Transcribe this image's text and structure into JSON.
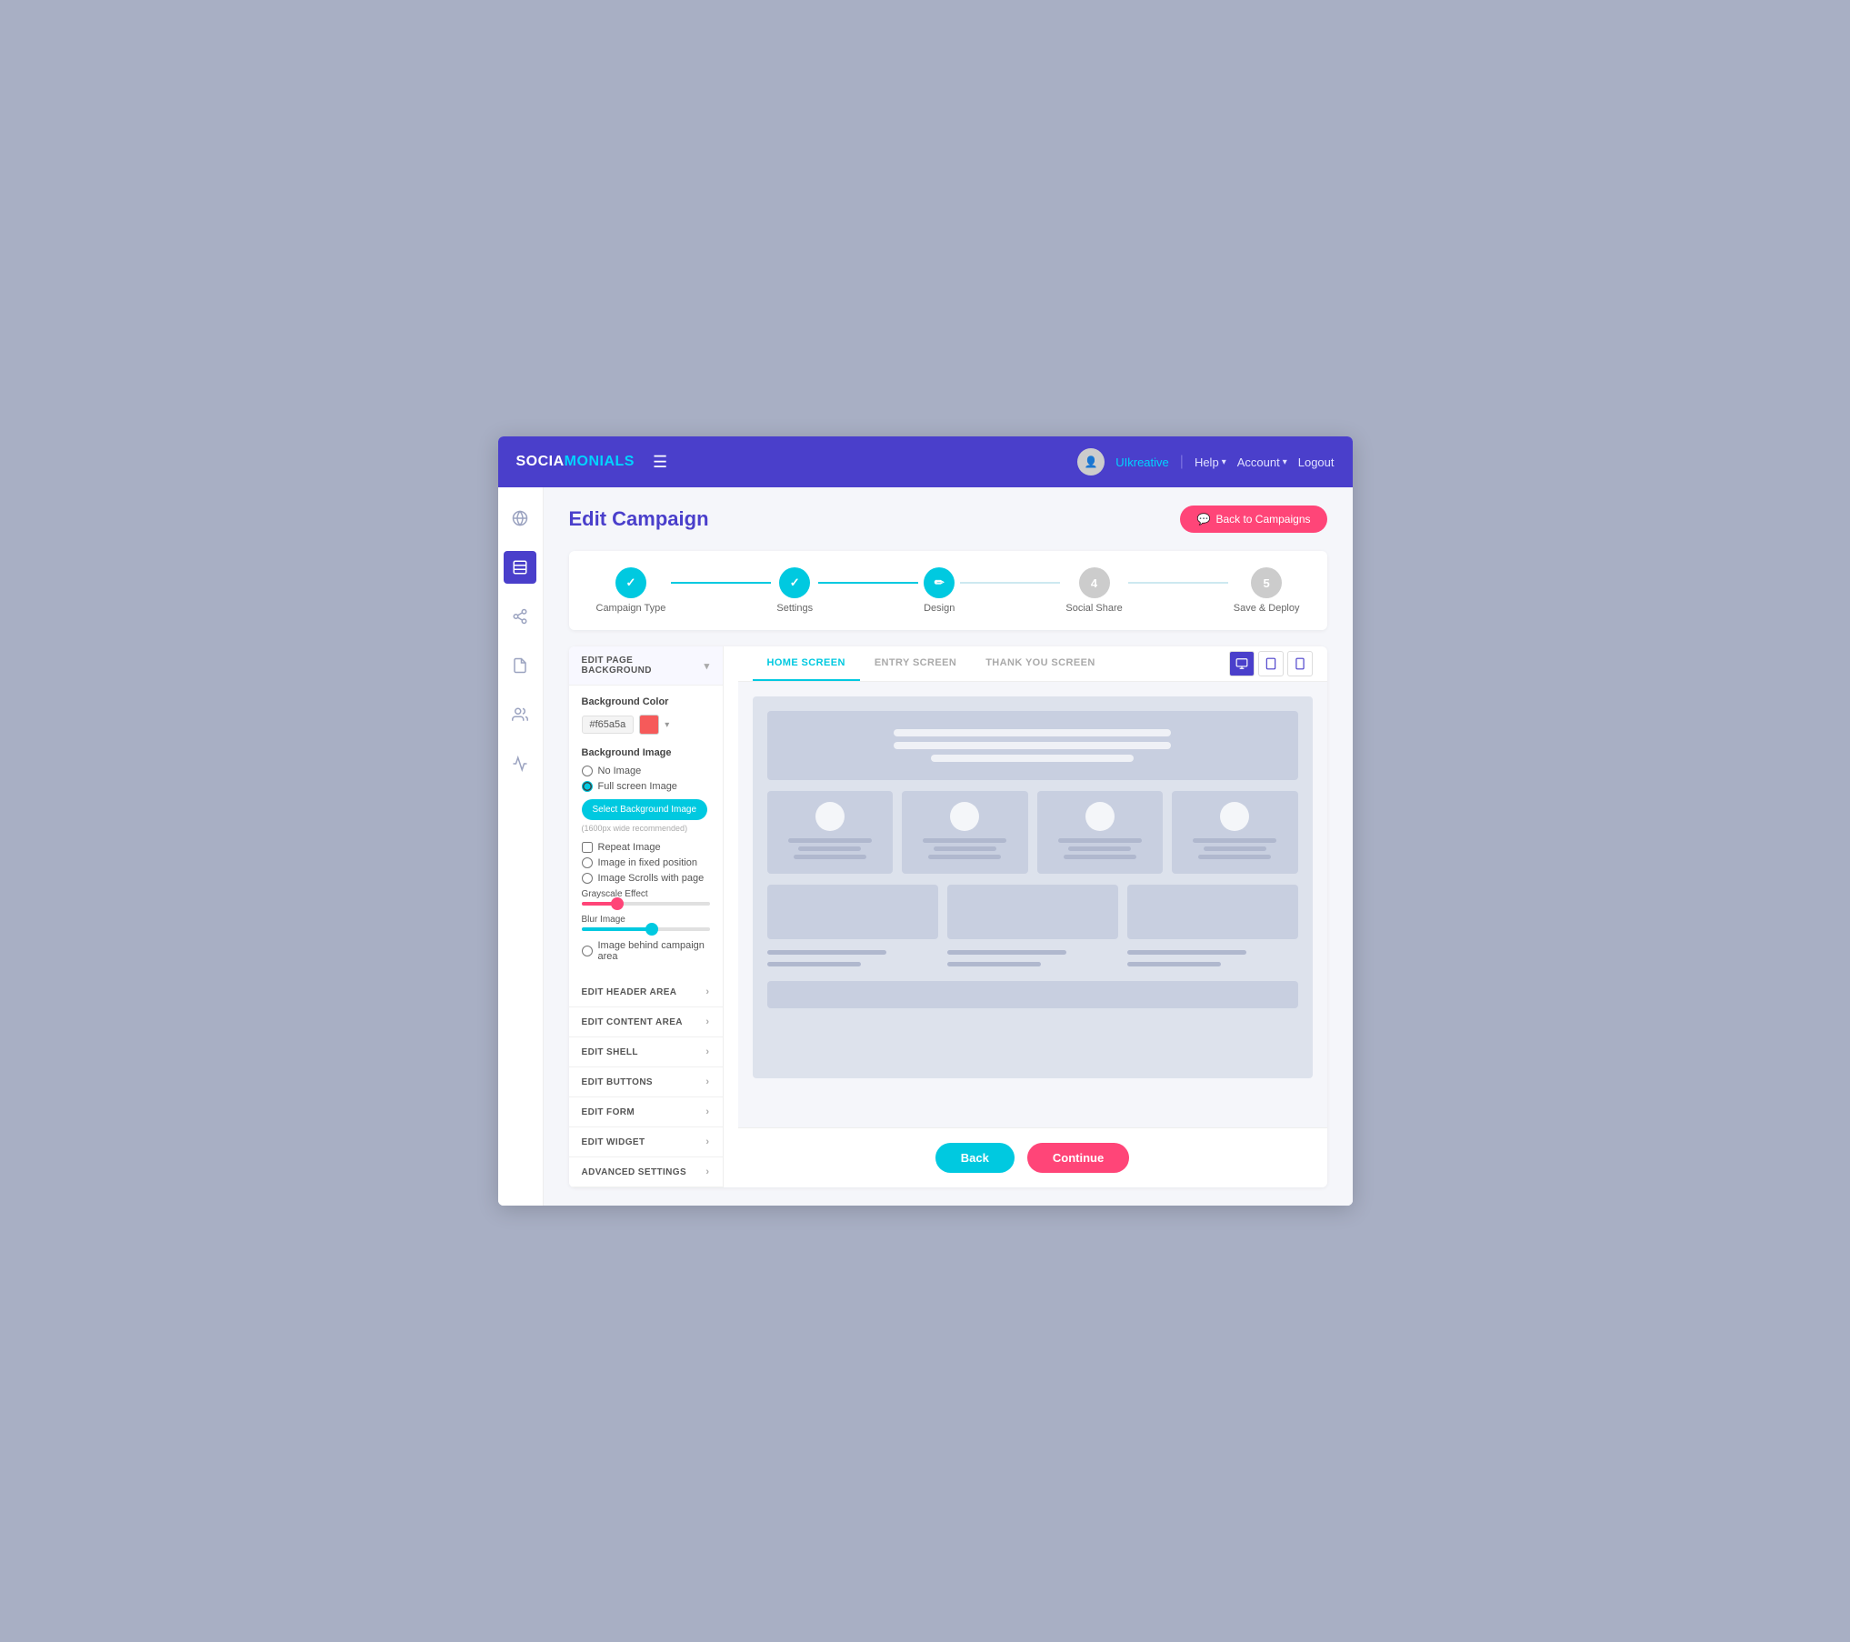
{
  "app": {
    "logo_prefix": "SOCIA",
    "logo_highlight": "MONIALS"
  },
  "nav": {
    "hamburger": "☰",
    "username": "UIkreative",
    "help_label": "Help",
    "account_label": "Account",
    "logout_label": "Logout"
  },
  "page": {
    "title": "Edit Campaign",
    "back_btn": "Back to Campaigns"
  },
  "steps": [
    {
      "id": "campaign-type",
      "label": "Campaign Type",
      "state": "done",
      "icon": "check"
    },
    {
      "id": "settings",
      "label": "Settings",
      "state": "done",
      "icon": "check"
    },
    {
      "id": "design",
      "label": "Design",
      "state": "active",
      "icon": "pen"
    },
    {
      "id": "social-share",
      "label": "Social Share",
      "state": "inactive",
      "number": "4"
    },
    {
      "id": "save-deploy",
      "label": "Save  & Deploy",
      "state": "inactive",
      "number": "5"
    }
  ],
  "left_panel": {
    "dropdown_label": "EDIT PAGE BACKGROUND",
    "bg_color_label": "Background Color",
    "bg_color_value": "#f65a5a",
    "bg_image_label": "Background Image",
    "radio_no_image": "No Image",
    "radio_fullscreen": "Full screen Image",
    "select_bg_btn": "Select Background Image",
    "hint_text": "(1600px wide recommended)",
    "checkbox_repeat": "Repeat Image",
    "radio_fixed": "Image in fixed position",
    "radio_scrolls": "Image Scrolls with page",
    "grayscale_label": "Grayscale Effect",
    "blur_label": "Blur Image",
    "grayscale_pct": 28,
    "blur_pct": 55,
    "image_behind_label": "Image behind campaign area",
    "sections": [
      {
        "id": "edit-header-area",
        "label": "EDIT HEADER AREA"
      },
      {
        "id": "edit-content-area",
        "label": "EDIT CONTENT AREA"
      },
      {
        "id": "edit-shell",
        "label": "EDIT SHELL"
      },
      {
        "id": "edit-buttons",
        "label": "EDIT BUTTONS"
      },
      {
        "id": "edit-form",
        "label": "EDIT FORM"
      },
      {
        "id": "edit-widget",
        "label": "EDIT WIDGET"
      },
      {
        "id": "advanced-settings",
        "label": "ADVANCED SETTINGS"
      }
    ]
  },
  "tabs": [
    {
      "id": "home-screen",
      "label": "HOME SCREEN",
      "active": true
    },
    {
      "id": "entry-screen",
      "label": "ENTRY SCREEN",
      "active": false
    },
    {
      "id": "thank-you-screen",
      "label": "THANK YOU SCREEN",
      "active": false
    }
  ],
  "view_icons": [
    {
      "id": "desktop",
      "symbol": "🖥",
      "active": true
    },
    {
      "id": "tablet",
      "symbol": "📱",
      "active": false
    },
    {
      "id": "mobile",
      "symbol": "⊟",
      "active": false
    }
  ],
  "bottom_actions": {
    "back_label": "Back",
    "continue_label": "Continue"
  }
}
